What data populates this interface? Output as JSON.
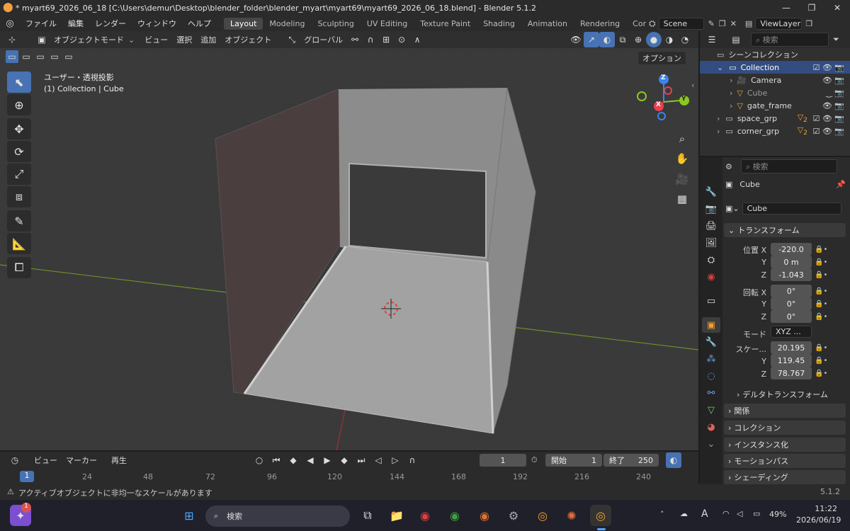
{
  "window": {
    "title": "* myart69_2026_06_18 [C:\\Users\\demur\\Desktop\\blender_folder\\blender_myart\\myart69\\myart69_2026_06_18.blend] - Blender 5.1.2",
    "minimize": "—",
    "maximize": "❐",
    "close": "✕"
  },
  "menu": [
    "ファイル",
    "編集",
    "レンダー",
    "ウィンドウ",
    "ヘルプ"
  ],
  "workspaces": [
    "Layout",
    "Modeling",
    "Sculpting",
    "UV Editing",
    "Texture Paint",
    "Shading",
    "Animation",
    "Rendering",
    "Compositing"
  ],
  "scene": "Scene",
  "view_layer": "ViewLayer",
  "viewport": {
    "mode": "オブジェクトモード",
    "menus": [
      "ビュー",
      "選択",
      "追加",
      "オブジェクト"
    ],
    "orientation": "グローバル",
    "options_label": "オプション",
    "view_name": "ユーザー・透視投影",
    "collection_info": "(1) Collection | Cube",
    "gizmo": {
      "z": "Z",
      "y": "Y",
      "x": "X"
    }
  },
  "outliner": {
    "search_placeholder": "検索",
    "root": "シーンコレクション",
    "rows": [
      {
        "name": "Collection"
      },
      {
        "name": "Camera"
      },
      {
        "name": "Cube"
      },
      {
        "name": "gate_frame"
      },
      {
        "name": "space_grp",
        "count": "2"
      },
      {
        "name": "corner_grp",
        "count": "2"
      }
    ]
  },
  "properties": {
    "search_placeholder": "検索",
    "object_name": "Cube",
    "object_field": "Cube",
    "transform_label": "トランスフォーム",
    "location_label": "位置 X",
    "rotation_label": "回転 X",
    "scale_label": "スケー...",
    "y_label": "Y",
    "z_label": "Z",
    "mode_label": "モード",
    "location": [
      "-220.0",
      "0 m",
      "-1.043"
    ],
    "rotation": [
      "0°",
      "0°",
      "0°"
    ],
    "rotation_mode": "XYZ ...",
    "scale": [
      "20.195",
      "119.45",
      "78.767"
    ],
    "delta_transform": "デルタトランスフォーム",
    "sections": [
      "関係",
      "コレクション",
      "インスタンス化",
      "モーションパス",
      "シェーディング"
    ]
  },
  "timeline": {
    "menus": [
      "ビュー",
      "マーカー",
      "再生"
    ],
    "current_frame": "1",
    "start_label": "開始",
    "start": "1",
    "end_label": "終了",
    "end": "250",
    "ticks": [
      "1",
      "24",
      "48",
      "72",
      "96",
      "120",
      "144",
      "168",
      "192",
      "216",
      "240"
    ]
  },
  "status": {
    "warning": "アクティブオブジェクトに非均一なスケールがあります",
    "version": "5.1.2"
  },
  "taskbar": {
    "search_placeholder": "検索",
    "notification_count": "1",
    "language": "A",
    "battery": "49%",
    "time": "11:22",
    "date": "2026/06/19"
  },
  "colors": {
    "accent": "#4772b3",
    "gizmo_x": "#e8404f",
    "gizmo_y": "#8cc820",
    "gizmo_z": "#3c84ea"
  }
}
